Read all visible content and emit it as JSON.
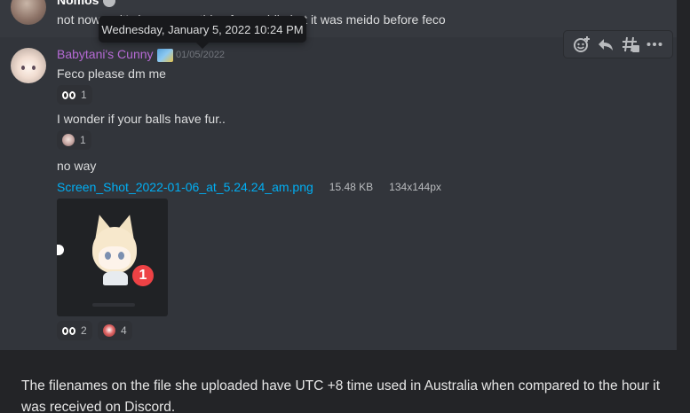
{
  "previous_message": {
    "author": "Nomos",
    "text": "not now … it's been something for a while but it was meido before feco"
  },
  "tooltip": {
    "text": "Wednesday, January 5, 2022 10:24 PM"
  },
  "toolbar": {
    "icons": [
      "add-reaction-icon",
      "reply-icon",
      "create-thread-icon",
      "more-options-icon"
    ]
  },
  "message": {
    "author": "Babytani's Cunny",
    "author_color": "#b56ad4",
    "timestamp": "01/05/2022",
    "lines": [
      {
        "text": "Feco please dm me",
        "reactions": [
          {
            "emoji": "eyes",
            "count": "1"
          }
        ]
      },
      {
        "text": "I wonder if your balls have fur..",
        "reactions": [
          {
            "emoji": "anime-face",
            "count": "1"
          }
        ]
      },
      {
        "text": "no way"
      }
    ],
    "attachment": {
      "filename": "Screen_Shot_2022-01-06_at_5.24.24_am.png",
      "size": "15.48 KB",
      "dimensions": "134x144px",
      "badge_number": "1"
    },
    "attachment_reactions": [
      {
        "emoji": "eyes",
        "count": "2"
      },
      {
        "emoji": "anime-face-red",
        "count": "4"
      }
    ]
  },
  "caption": {
    "text": "The filenames on the file she uploaded have UTC +8 time used in Australia when compared to the hour it was received on Discord."
  },
  "colors": {
    "background": "#36393f",
    "link": "#00aff4",
    "text": "#dcddde",
    "badge": "#ed4245"
  }
}
